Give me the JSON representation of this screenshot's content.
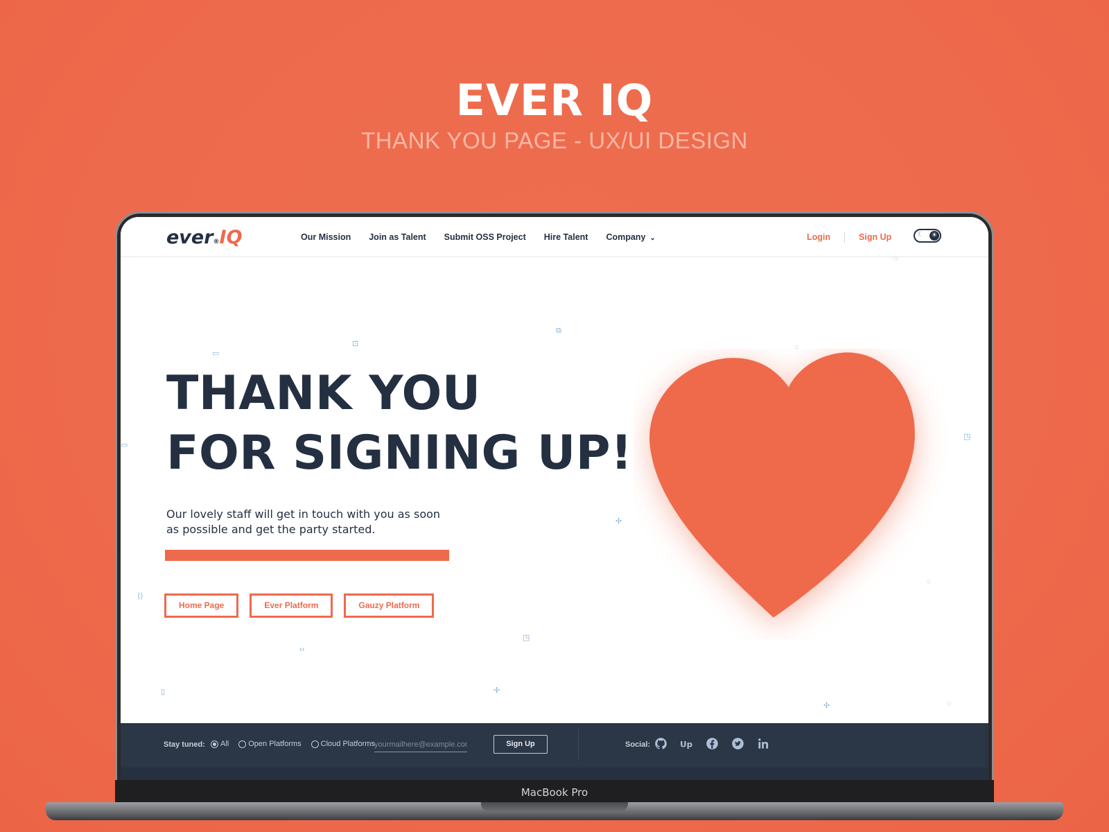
{
  "header": {
    "title": "EVER IQ",
    "subtitle": "THANK YOU PAGE - UX/UI DESIGN"
  },
  "device": {
    "label": "MacBook Pro"
  },
  "nav": {
    "logo_ever": "ever",
    "logo_iq": "IQ",
    "links": [
      "Our Mission",
      "Join as Talent",
      "Submit OSS Project",
      "Hire Talent",
      "Company"
    ],
    "login": "Login",
    "signup": "Sign Up"
  },
  "hero": {
    "heading_line1": "THANK YOU",
    "heading_line2": "FOR SIGNING UP!",
    "text": "Our lovely staff will get in touch with you as soon as possible and get the party started.",
    "buttons": [
      "Home Page",
      "Ever Platform",
      "Gauzy Platform"
    ]
  },
  "footer": {
    "stay_label": "Stay tuned:",
    "options": [
      {
        "label": "All",
        "selected": true
      },
      {
        "label": "Open Platforms",
        "selected": false
      },
      {
        "label": "Cloud Platforms",
        "selected": false
      }
    ],
    "email_placeholder": "yourmailhere@example.com",
    "signup_button": "Sign Up",
    "social_label": "Social:",
    "social_icons": [
      "github-icon",
      "upwork-icon",
      "facebook-icon",
      "twitter-icon",
      "linkedin-icon"
    ]
  },
  "colors": {
    "accent": "#ee6a4c",
    "dark": "#243041",
    "footer_bg": "#2b3646"
  }
}
